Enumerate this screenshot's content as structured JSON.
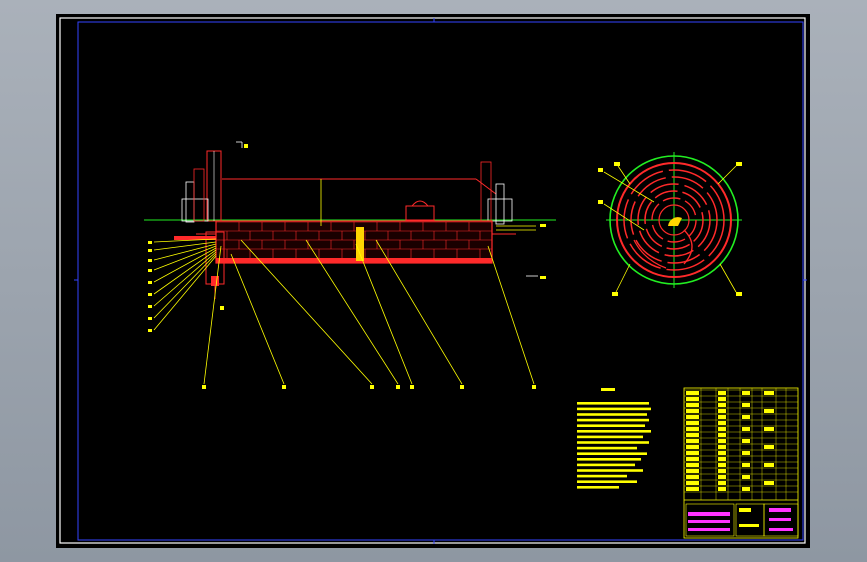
{
  "window": {
    "background_color": "#9aa3ad",
    "sheet_color": "#000000"
  },
  "drawing": {
    "frame_color": "#3344ff",
    "outline_color": "#ff2a2a",
    "leader_color": "#ffff00",
    "centerline_color": "#22ee22",
    "hatch_color": "#ff2a2a",
    "accent_color": "#ffd400",
    "section_labels": [],
    "title_block": {
      "table_color": "#ffff00",
      "stamp_color": "#ff33ff"
    }
  }
}
